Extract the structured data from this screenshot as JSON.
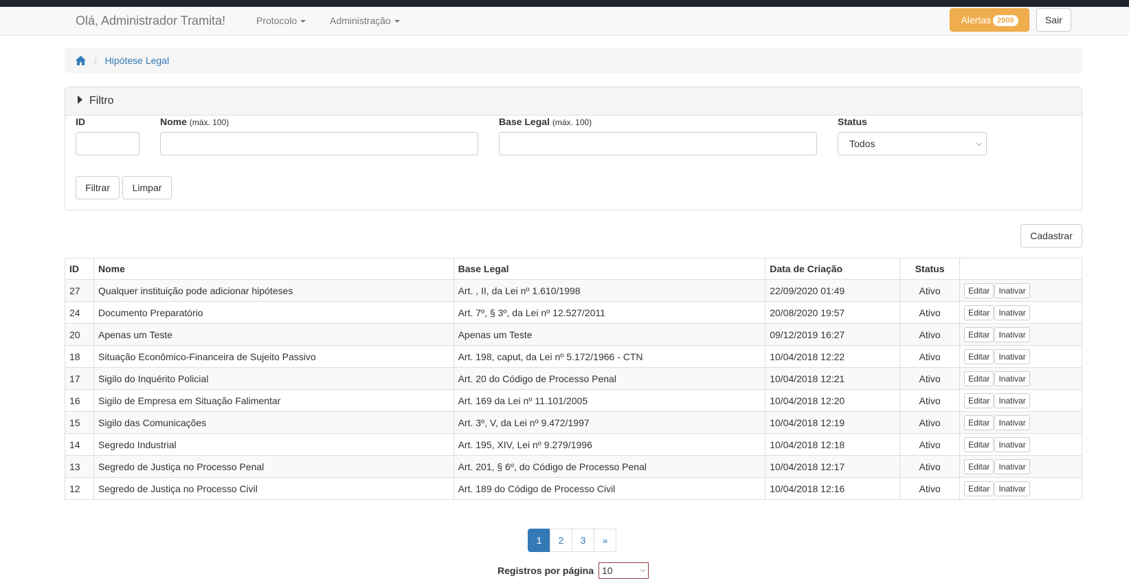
{
  "navbar": {
    "brand": "Olá, Administrador Tramita!",
    "menu": [
      {
        "label": "Protocolo"
      },
      {
        "label": "Administração"
      }
    ],
    "alerts_label": "Alertas",
    "alerts_count": "2909",
    "logout_label": "Sair",
    "alert_color": "#f0ad4e"
  },
  "breadcrumb": {
    "current": "Hipótese Legal"
  },
  "filter": {
    "title": "Filtro",
    "id_label": "ID",
    "name_label": "Nome",
    "name_hint": "(máx. 100)",
    "base_label": "Base Legal",
    "base_hint": "(máx. 100)",
    "status_label": "Status",
    "status_value": "Todos",
    "filter_button": "Filtrar",
    "clear_button": "Limpar"
  },
  "actions": {
    "create_button": "Cadastrar"
  },
  "table": {
    "headers": {
      "id": "ID",
      "name": "Nome",
      "base": "Base Legal",
      "date": "Data de Criação",
      "status": "Status"
    },
    "edit_label": "Editar",
    "deactivate_label": "Inativar",
    "rows": [
      {
        "id": "27",
        "name": "Qualquer instituição pode adicionar hipóteses",
        "base": "Art. , II, da Lei nº 1.610/1998",
        "date": "22/09/2020 01:49",
        "status": "Ativo"
      },
      {
        "id": "24",
        "name": "Documento Preparatório",
        "base": "Art. 7º, § 3º, da Lei nº 12.527/2011",
        "date": "20/08/2020 19:57",
        "status": "Ativo"
      },
      {
        "id": "20",
        "name": "Apenas um Teste",
        "base": "Apenas um Teste",
        "date": "09/12/2019 16:27",
        "status": "Ativo"
      },
      {
        "id": "18",
        "name": "Situação Econômico-Financeira de Sujeito Passivo",
        "base": "Art. 198, caput, da Lei nº 5.172/1966 - CTN",
        "date": "10/04/2018 12:22",
        "status": "Ativo"
      },
      {
        "id": "17",
        "name": "Sigilo do Inquérito Policial",
        "base": "Art. 20 do Código de Processo Penal",
        "date": "10/04/2018 12:21",
        "status": "Ativo"
      },
      {
        "id": "16",
        "name": "Sigilo de Empresa em Situação Falimentar",
        "base": "Art. 169 da Lei nº 11.101/2005",
        "date": "10/04/2018 12:20",
        "status": "Ativo"
      },
      {
        "id": "15",
        "name": "Sigilo das Comunicações",
        "base": "Art. 3º, V, da Lei nº 9.472/1997",
        "date": "10/04/2018 12:19",
        "status": "Ativo"
      },
      {
        "id": "14",
        "name": "Segredo Industrial",
        "base": "Art. 195, XIV, Lei nº 9.279/1996",
        "date": "10/04/2018 12:18",
        "status": "Ativo"
      },
      {
        "id": "13",
        "name": "Segredo de Justiça no Processo Penal",
        "base": "Art. 201, § 6º, do Código de Processo Penal",
        "date": "10/04/2018 12:17",
        "status": "Ativo"
      },
      {
        "id": "12",
        "name": "Segredo de Justiça no Processo Civil",
        "base": "Art. 189 do Código de Processo Civil",
        "date": "10/04/2018 12:16",
        "status": "Ativo"
      }
    ]
  },
  "pagination": {
    "pages": [
      "1",
      "2",
      "3"
    ],
    "next": "»",
    "active": "1"
  },
  "per_page": {
    "label": "Registros por página",
    "value": "10"
  }
}
